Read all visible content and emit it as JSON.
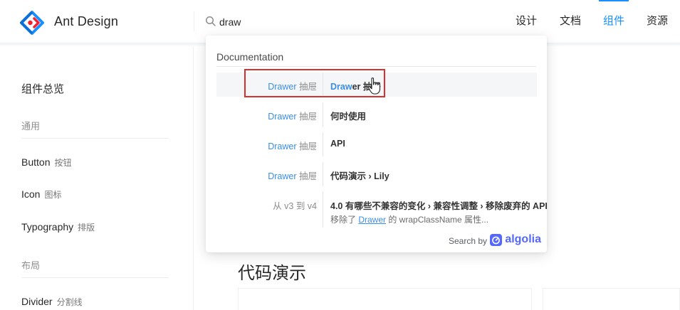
{
  "header": {
    "brand": "Ant Design",
    "search": {
      "value": "draw",
      "placeholder": ""
    },
    "nav": [
      "设计",
      "文档",
      "组件",
      "资源"
    ],
    "active_nav": "组件"
  },
  "sidebar": {
    "overview": "组件总览",
    "groups": [
      "通用",
      "布局"
    ],
    "items": [
      {
        "label": "Button",
        "sub": "按钮"
      },
      {
        "label": "Icon",
        "sub": "图标"
      },
      {
        "label": "Typography",
        "sub": "排版"
      },
      {
        "label": "Divider",
        "sub": "分割线"
      }
    ]
  },
  "main": {
    "section_title": "代码演示"
  },
  "dropdown": {
    "section": "Documentation",
    "hits": [
      {
        "cat_hl": "Drawer",
        "cat_rest": " 抽屉",
        "title_hl": "Draw",
        "title_rest": "er 抽屉",
        "selected": true
      },
      {
        "cat_hl": "Drawer",
        "cat_rest": " 抽屉",
        "title": "何时使用"
      },
      {
        "cat_hl": "Drawer",
        "cat_rest": " 抽屉",
        "title": "API"
      },
      {
        "cat_hl": "Drawer",
        "cat_rest": " 抽屉",
        "title": "代码演示 › Lily"
      },
      {
        "cat": "从 v3 到 v4",
        "title": "4.0 有哪些不兼容的变化 › 兼容性调整 › 移除废弃的 API",
        "desc_pre": "移除了 ",
        "desc_hl": "Drawer",
        "desc_post": " 的 wrapClassName 属性..."
      }
    ],
    "search_by": "Search by",
    "provider": "algolia"
  },
  "colors": {
    "primary": "#1890ff",
    "highlight": "#3a8ee6",
    "annotation": "#d6302f",
    "algolia": "#5468ff"
  },
  "icons": [
    "ant-design-logo-icon",
    "search-icon",
    "algolia-logo-icon",
    "hand-pointer-cursor-icon"
  ]
}
